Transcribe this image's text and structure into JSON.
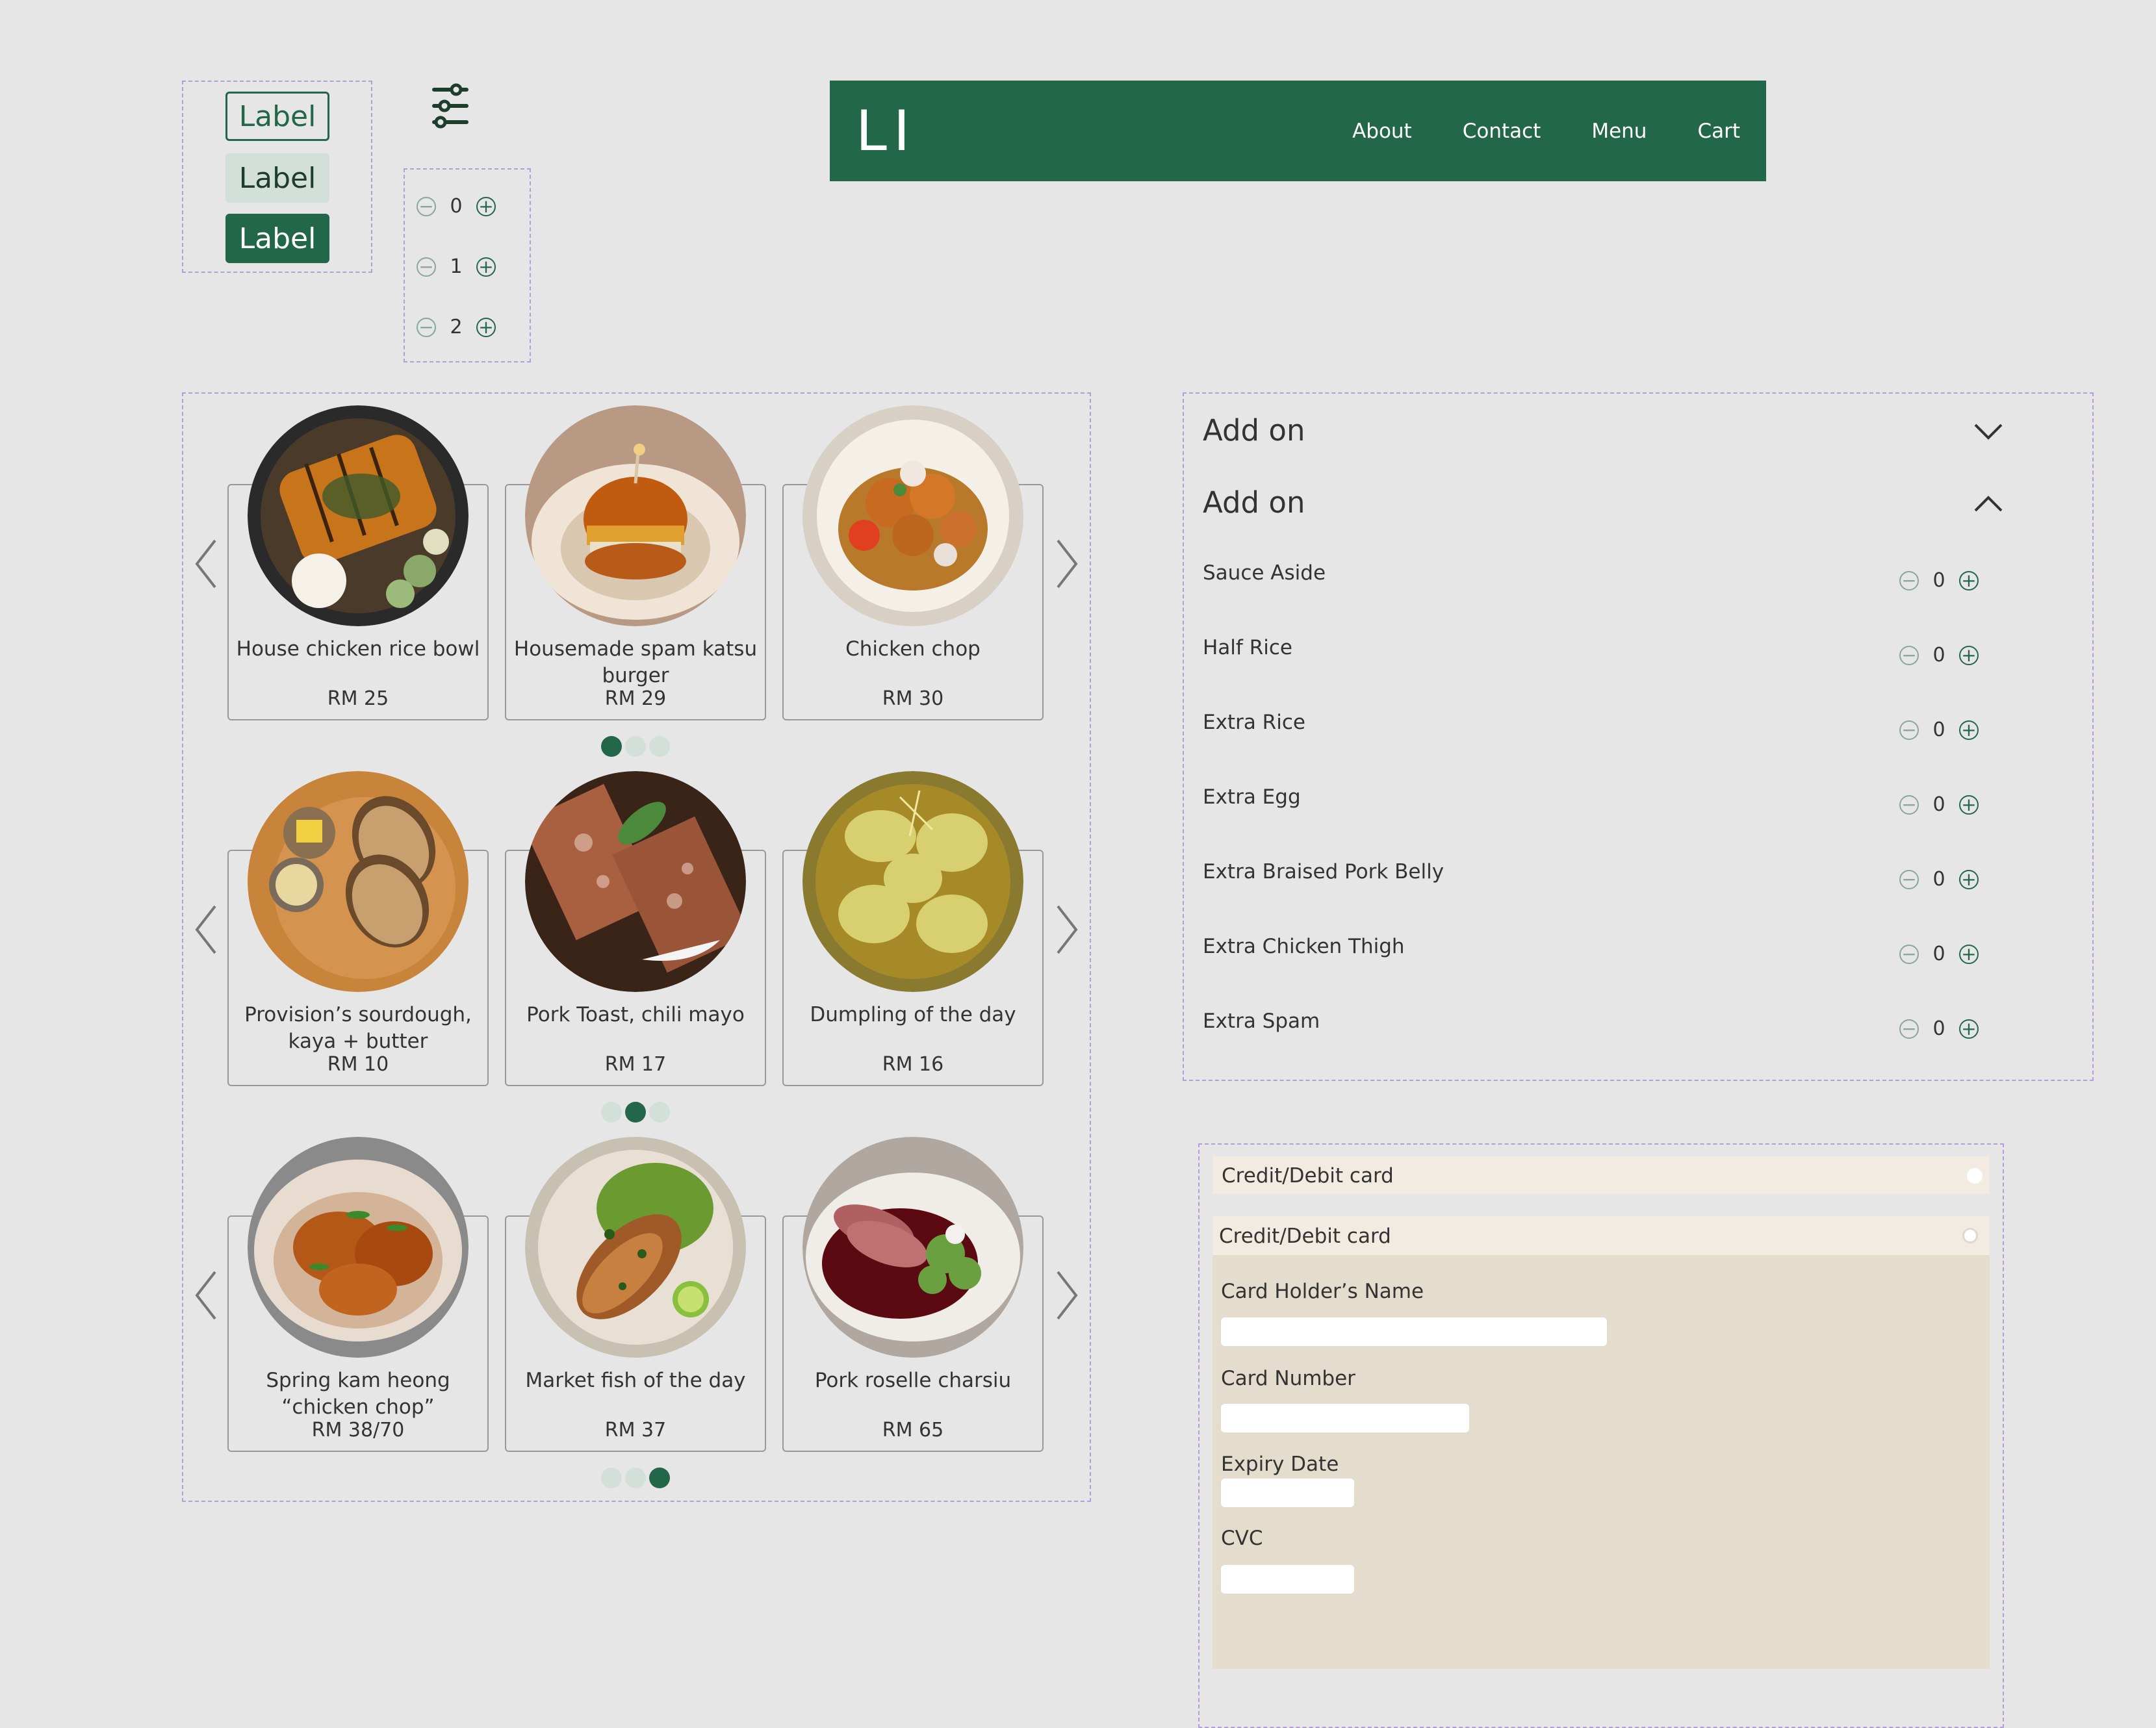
{
  "labels": [
    "Label",
    "Label",
    "Label"
  ],
  "steppers": [
    {
      "value": "0"
    },
    {
      "value": "1"
    },
    {
      "value": "2"
    }
  ],
  "icons": {
    "filter": "sliders-icon",
    "minus": "minus-circle-icon",
    "plus": "plus-circle-icon",
    "chevron_left": "chevron-left-icon",
    "chevron_right": "chevron-right-icon",
    "chevron_down": "chevron-down-icon",
    "chevron_up": "chevron-up-icon"
  },
  "nav": {
    "logo": "LI",
    "links": [
      "About",
      "Contact",
      "Menu",
      "Cart"
    ]
  },
  "colors": {
    "primary": "#23674a",
    "background": "#e6e6e6",
    "payment_header": "#f2ebe1",
    "payment_body": "#e4dccc",
    "outline": "#b39ddb"
  },
  "carousels": [
    {
      "items": [
        {
          "name": "House chicken rice bowl",
          "price": "RM 25"
        },
        {
          "name": "Housemade spam katsu burger",
          "price": "RM 29"
        },
        {
          "name": "Chicken chop",
          "price": "RM 30"
        }
      ],
      "active_page": 1,
      "pages": 3
    },
    {
      "items": [
        {
          "name": "Provision’s sourdough, kaya + butter",
          "price": "RM 10"
        },
        {
          "name": "Pork Toast, chili mayo",
          "price": "RM 17"
        },
        {
          "name": "Dumpling of the day",
          "price": "RM 16"
        }
      ],
      "active_page": 2,
      "pages": 3
    },
    {
      "items": [
        {
          "name": "Spring kam heong “chicken chop”",
          "price": "RM 38/70"
        },
        {
          "name": "Market fish of the day",
          "price": "RM 37"
        },
        {
          "name": "Pork roselle charsiu",
          "price": "RM 65"
        }
      ],
      "active_page": 3,
      "pages": 3
    }
  ],
  "addon": {
    "collapsed_title": "Add on",
    "expanded_title": "Add on",
    "items": [
      {
        "label": "Sauce Aside",
        "qty": "0"
      },
      {
        "label": "Half Rice",
        "qty": "0"
      },
      {
        "label": "Extra Rice",
        "qty": "0"
      },
      {
        "label": "Extra Egg",
        "qty": "0"
      },
      {
        "label": "Extra Braised Pork Belly",
        "qty": "0"
      },
      {
        "label": "Extra Chicken Thigh",
        "qty": "0"
      },
      {
        "label": "Extra Spam",
        "qty": "0"
      }
    ]
  },
  "payment": {
    "option_collapsed": "Credit/Debit card",
    "option_expanded": "Credit/Debit card",
    "fields": {
      "holder": {
        "label": "Card Holder’s Name",
        "value": ""
      },
      "number": {
        "label": "Card Number",
        "value": ""
      },
      "expiry": {
        "label": "Expiry Date",
        "value": ""
      },
      "cvc": {
        "label": "CVC",
        "value": ""
      }
    }
  }
}
